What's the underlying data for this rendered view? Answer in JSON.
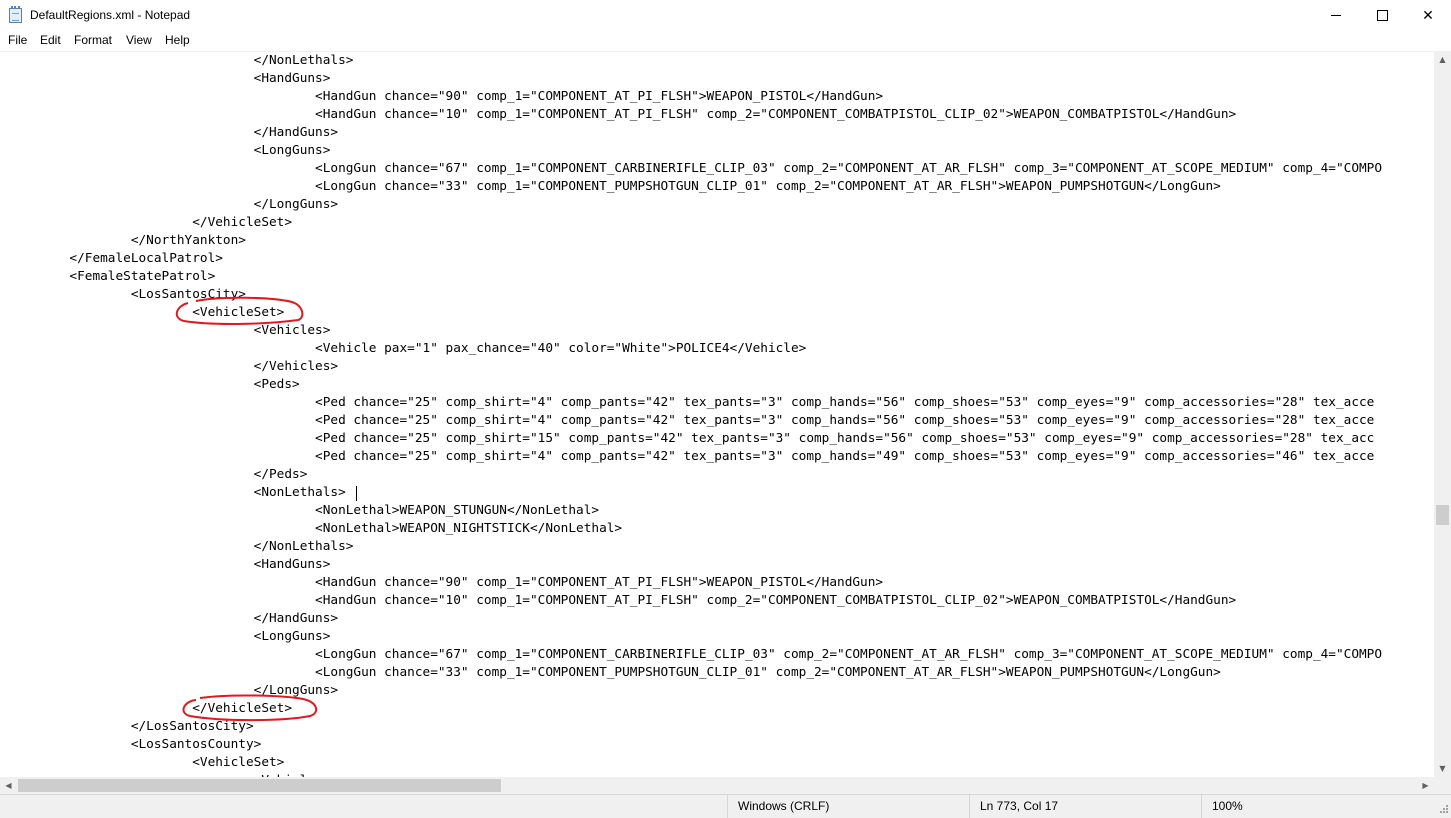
{
  "window": {
    "title": "DefaultRegions.xml - Notepad",
    "controls": {
      "minimize": "",
      "maximize": "",
      "close": "✕"
    }
  },
  "menu": [
    "File",
    "Edit",
    "Format",
    "View",
    "Help"
  ],
  "lines": [
    "                                </NonLethals>",
    "                                <HandGuns>",
    "                                        <HandGun chance=\"90\" comp_1=\"COMPONENT_AT_PI_FLSH\">WEAPON_PISTOL</HandGun>",
    "                                        <HandGun chance=\"10\" comp_1=\"COMPONENT_AT_PI_FLSH\" comp_2=\"COMPONENT_COMBATPISTOL_CLIP_02\">WEAPON_COMBATPISTOL</HandGun>",
    "                                </HandGuns>",
    "                                <LongGuns>",
    "                                        <LongGun chance=\"67\" comp_1=\"COMPONENT_CARBINERIFLE_CLIP_03\" comp_2=\"COMPONENT_AT_AR_FLSH\" comp_3=\"COMPONENT_AT_SCOPE_MEDIUM\" comp_4=\"COMPO",
    "                                        <LongGun chance=\"33\" comp_1=\"COMPONENT_PUMPSHOTGUN_CLIP_01\" comp_2=\"COMPONENT_AT_AR_FLSH\">WEAPON_PUMPSHOTGUN</LongGun>",
    "                                </LongGuns>",
    "                        </VehicleSet>",
    "                </NorthYankton>",
    "        </FemaleLocalPatrol>",
    "        <FemaleStatePatrol>",
    "                <LosSantosCity>",
    "                        <VehicleSet>",
    "                                <Vehicles>",
    "                                        <Vehicle pax=\"1\" pax_chance=\"40\" color=\"White\">POLICE4</Vehicle>",
    "                                </Vehicles>",
    "                                <Peds>",
    "                                        <Ped chance=\"25\" comp_shirt=\"4\" comp_pants=\"42\" tex_pants=\"3\" comp_hands=\"56\" comp_shoes=\"53\" comp_eyes=\"9\" comp_accessories=\"28\" tex_acce",
    "                                        <Ped chance=\"25\" comp_shirt=\"4\" comp_pants=\"42\" tex_pants=\"3\" comp_hands=\"56\" comp_shoes=\"53\" comp_eyes=\"9\" comp_accessories=\"28\" tex_acce",
    "                                        <Ped chance=\"25\" comp_shirt=\"15\" comp_pants=\"42\" tex_pants=\"3\" comp_hands=\"56\" comp_shoes=\"53\" comp_eyes=\"9\" comp_accessories=\"28\" tex_acc",
    "                                        <Ped chance=\"25\" comp_shirt=\"4\" comp_pants=\"42\" tex_pants=\"3\" comp_hands=\"49\" comp_shoes=\"53\" comp_eyes=\"9\" comp_accessories=\"46\" tex_acce",
    "                                </Peds>",
    "                                <NonLethals>",
    "                                        <NonLethal>WEAPON_STUNGUN</NonLethal>",
    "                                        <NonLethal>WEAPON_NIGHTSTICK</NonLethal>",
    "                                </NonLethals>",
    "                                <HandGuns>",
    "                                        <HandGun chance=\"90\" comp_1=\"COMPONENT_AT_PI_FLSH\">WEAPON_PISTOL</HandGun>",
    "                                        <HandGun chance=\"10\" comp_1=\"COMPONENT_AT_PI_FLSH\" comp_2=\"COMPONENT_COMBATPISTOL_CLIP_02\">WEAPON_COMBATPISTOL</HandGun>",
    "                                </HandGuns>",
    "                                <LongGuns>",
    "                                        <LongGun chance=\"67\" comp_1=\"COMPONENT_CARBINERIFLE_CLIP_03\" comp_2=\"COMPONENT_AT_AR_FLSH\" comp_3=\"COMPONENT_AT_SCOPE_MEDIUM\" comp_4=\"COMPO",
    "                                        <LongGun chance=\"33\" comp_1=\"COMPONENT_PUMPSHOTGUN_CLIP_01\" comp_2=\"COMPONENT_AT_AR_FLSH\">WEAPON_PUMPSHOTGUN</LongGun>",
    "                                </LongGuns>",
    "                        </VehicleSet>",
    "                </LosSantosCity>",
    "                <LosSantosCounty>",
    "                        <VehicleSet>",
    "                                <Vehicl"
  ],
  "status": {
    "line_ending": "Windows (CRLF)",
    "position": "Ln 773, Col 17",
    "zoom": "100%"
  },
  "colors": {
    "annotation": "#e0191f",
    "chrome": "#f0f0f0",
    "scroll_thumb": "#cdcdcd"
  },
  "icons": {
    "app": "notepad-icon",
    "minimize": "minimize-icon",
    "maximize": "maximize-icon",
    "close": "close-icon"
  }
}
